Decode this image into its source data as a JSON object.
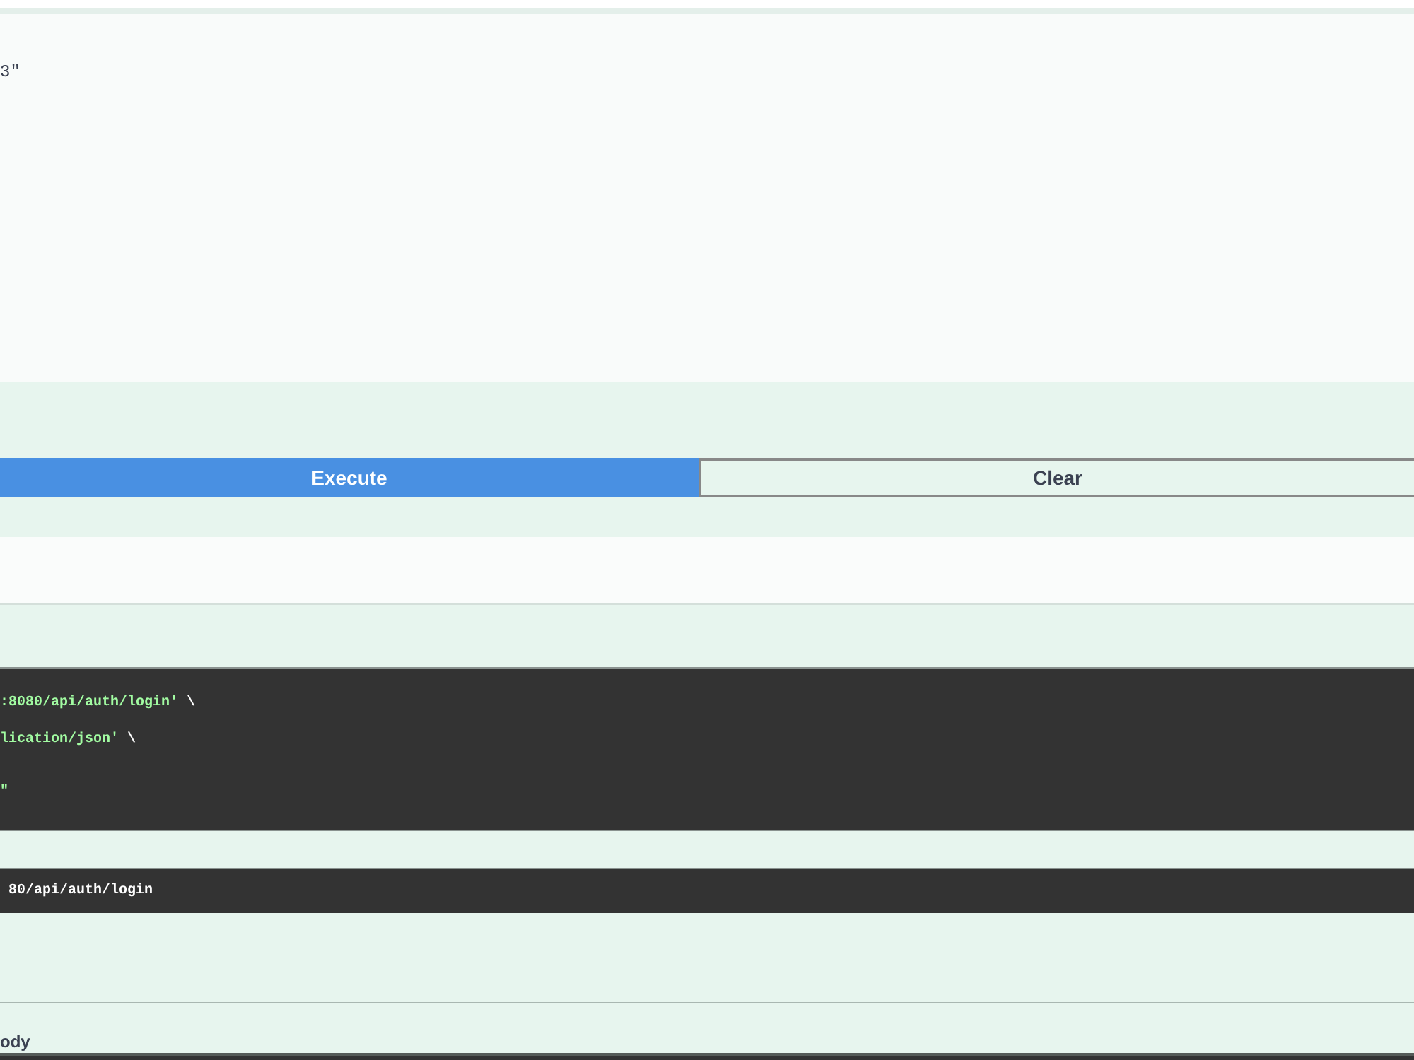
{
  "request_body": {
    "text": "3\""
  },
  "actions": [
    {
      "label": "Execute",
      "kind": "primary"
    },
    {
      "label": "Clear",
      "kind": "secondary"
    }
  ],
  "curl": {
    "lines": [
      {
        "segments": [
          {
            "text": ":8080/api/auth/login'",
            "kind": "string"
          },
          {
            "text": " \\",
            "kind": "plain"
          }
        ]
      },
      {
        "segments": [
          {
            "text": "lication/json'",
            "kind": "string"
          },
          {
            "text": " \\",
            "kind": "plain"
          }
        ]
      },
      {
        "segments": [
          {
            "text": "\"",
            "kind": "string"
          }
        ]
      }
    ]
  },
  "request_url": {
    "text": "80/api/auth/login"
  },
  "response_body": {
    "label": "ody"
  }
}
